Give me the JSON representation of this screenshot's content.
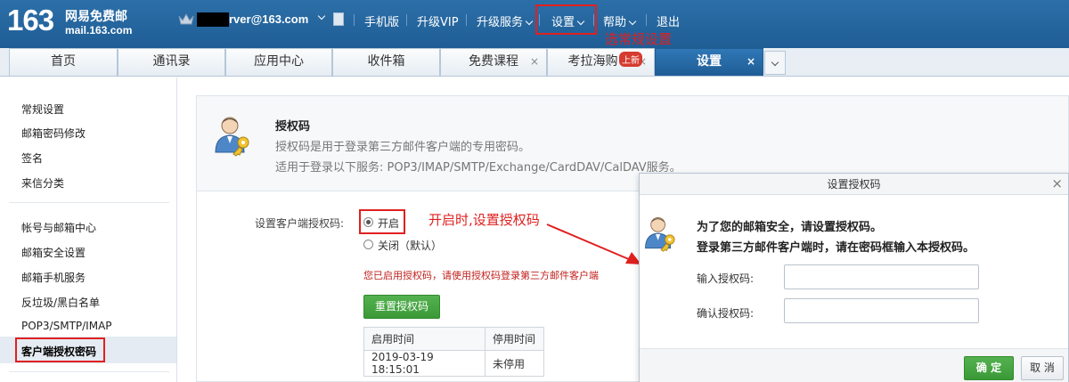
{
  "colors": {
    "header_blue": "#1f5d95",
    "accent_red": "#e02020",
    "button_green": "#3b9a37",
    "warn_red": "#c0201d"
  },
  "logo": {
    "number": "163",
    "name": "网易免费邮",
    "domain": "mail.163.com"
  },
  "user": {
    "email_suffix": "rver@163.com",
    "crown_icon": "crown-icon",
    "doc_icon": "document-icon"
  },
  "nav": {
    "mobile": "手机版",
    "vip": "升级VIP",
    "service": "升级服务",
    "settings": "设置",
    "help": "帮助",
    "logout": "退出"
  },
  "annotations": {
    "settings_hint": "选常规设置",
    "enable_hint": "开启时,设置授权码"
  },
  "tabs": [
    {
      "label": "首页"
    },
    {
      "label": "通讯录"
    },
    {
      "label": "应用中心"
    },
    {
      "label": "收件箱"
    },
    {
      "label": "免费课程",
      "close": "×"
    },
    {
      "label": "考拉海购",
      "close": "×",
      "badge": "上新"
    },
    {
      "label": "设置",
      "close": "×"
    }
  ],
  "sidebar": {
    "group1": [
      "常规设置",
      "邮箱密码修改",
      "签名",
      "来信分类"
    ],
    "group2": [
      "帐号与邮箱中心",
      "邮箱安全设置",
      "邮箱手机服务",
      "反垃圾/黑白名单",
      "POP3/SMTP/IMAP",
      "客户端授权密码"
    ]
  },
  "section": {
    "title": "授权码",
    "desc1": "授权码是用于登录第三方邮件客户端的专用密码。",
    "desc2": "适用于登录以下服务: POP3/IMAP/SMTP/Exchange/CardDAV/CalDAV服务。"
  },
  "form": {
    "label": "设置客户端授权码:",
    "option_on": "开启",
    "option_off": "关闭（默认）",
    "warning": "您已启用授权码，请使用授权码登录第三方邮件客户端",
    "reset_button": "重置授权码",
    "table_headers": [
      "启用时间",
      "停用时间"
    ],
    "table_rows": [
      [
        "2019-03-19 18:15:01",
        "未停用"
      ]
    ]
  },
  "dialog": {
    "title": "设置授权码",
    "close": "×",
    "line1": "为了您的邮箱安全，请设置授权码。",
    "line2": "登录第三方邮件客户端时，请在密码框输入本授权码。",
    "input_label": "输入授权码:",
    "confirm_label": "确认授权码:",
    "input_value": "",
    "confirm_value": "",
    "ok": "确 定",
    "cancel": "取 消"
  }
}
